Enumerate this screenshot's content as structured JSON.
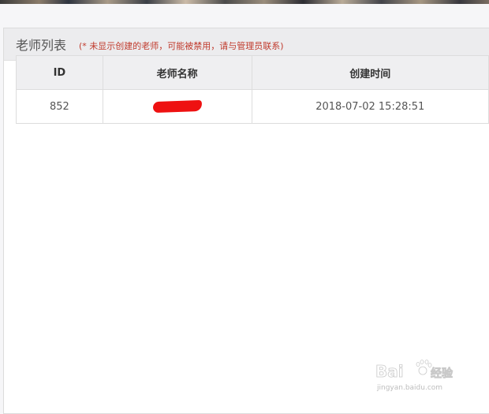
{
  "panel": {
    "title": "老师列表",
    "note": "(* 未显示创建的老师，可能被禁用，请与管理员联系)"
  },
  "table": {
    "columns": [
      "ID",
      "老师名称",
      "创建时间"
    ],
    "rows": [
      {
        "id": "852",
        "name": "[redacted]",
        "created": "2018-07-02 15:28:51"
      }
    ]
  },
  "watermark": {
    "brand": "Bai",
    "brand2": "du",
    "cn": "经验",
    "url": "jingyan.baidu.com"
  },
  "colors": {
    "note_red": "#c0392b",
    "redaction_red": "#ee1111"
  }
}
